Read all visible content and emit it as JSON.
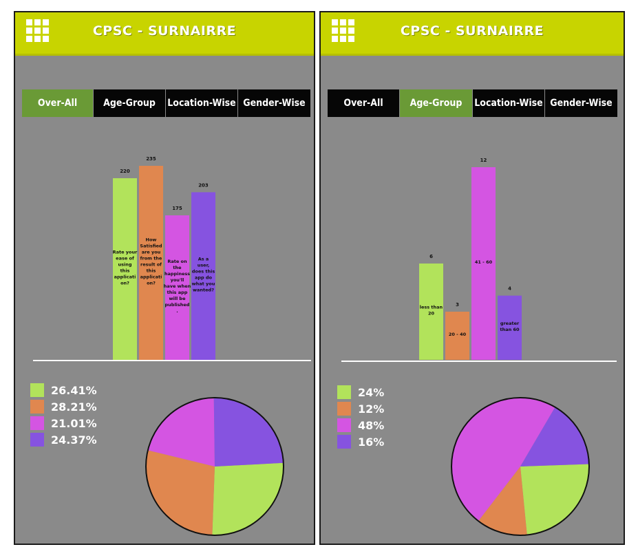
{
  "colors": {
    "header": "#c8d400",
    "panel_bg": "#8a8a8a",
    "tab_active": "#6a9a36",
    "tab_inactive": "#060606",
    "green": "#b2e35b",
    "orange": "#e0874f",
    "magenta": "#d455e2",
    "purple": "#8653e0"
  },
  "panels": [
    {
      "title": "CPSC - SURNAIRRE",
      "menu_icon": "grid-menu-icon",
      "tabs": [
        "Over-All",
        "Age-Group",
        "Location-Wise",
        "Gender-Wise"
      ],
      "active_tab": "Over-All",
      "legend": [
        "26.41%",
        "28.21%",
        "21.01%",
        "24.37%"
      ]
    },
    {
      "title": "CPSC - SURNAIRRE",
      "menu_icon": "grid-menu-icon",
      "tabs": [
        "Over-All",
        "Age-Group",
        "Location-Wise",
        "Gender-Wise"
      ],
      "active_tab": "Age-Group",
      "legend": [
        "24%",
        "12%",
        "48%",
        "16%"
      ]
    }
  ],
  "chart_data": [
    {
      "type": "bar",
      "categories": [
        "Rate your ease of using this application?",
        "How Satisfied are you from the result of this application?",
        "Rate on the happiness you'll have when this app will be published.",
        "As a user, does this app do what you wanted?"
      ],
      "values": [
        220,
        235,
        175,
        203
      ],
      "colors": [
        "#b2e35b",
        "#e0874f",
        "#d455e2",
        "#8653e0"
      ],
      "ylim": [
        0,
        235
      ]
    },
    {
      "type": "pie",
      "labels": [
        "26.41%",
        "28.21%",
        "21.01%",
        "24.37%"
      ],
      "values": [
        26.41,
        28.21,
        21.01,
        24.37
      ],
      "colors": [
        "#b2e35b",
        "#e0874f",
        "#d455e2",
        "#8653e0"
      ]
    },
    {
      "type": "bar",
      "categories": [
        "less than 20",
        "20 - 40",
        "41 - 60",
        "greater than 60"
      ],
      "values": [
        6,
        3,
        12,
        4
      ],
      "colors": [
        "#b2e35b",
        "#e0874f",
        "#d455e2",
        "#8653e0"
      ],
      "ylim": [
        0,
        12
      ]
    },
    {
      "type": "pie",
      "labels": [
        "24%",
        "12%",
        "48%",
        "16%"
      ],
      "values": [
        24,
        12,
        48,
        16
      ],
      "colors": [
        "#b2e35b",
        "#e0874f",
        "#d455e2",
        "#8653e0"
      ]
    }
  ]
}
